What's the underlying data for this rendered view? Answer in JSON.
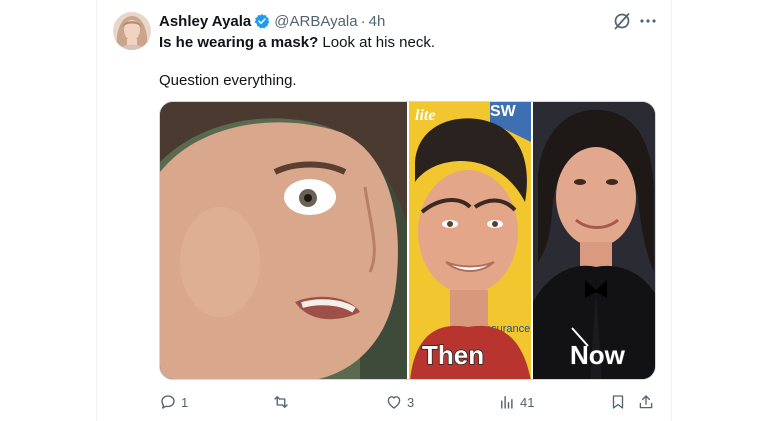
{
  "tweet": {
    "author_name": "Ashley Ayala",
    "handle": "@ARBAyala",
    "separator": "·",
    "time": "4h",
    "text_bold": "Is he wearing a mask?",
    "text_rest": " Look at his neck.",
    "text_line2": "Question everything.",
    "verified_color": "#1d9bf0"
  },
  "media": {
    "caption_then": "Then",
    "caption_now": "Now",
    "bg_text_left": "lite",
    "bg_text_top": "SW",
    "bg_text_side": "esurance"
  },
  "actions": {
    "reply_count": "1",
    "repost_count": "",
    "like_count": "3",
    "views_count": "41"
  },
  "colors": {
    "secondary_text": "#536471",
    "border": "#cfd9de",
    "brand_blue": "#1d9bf0"
  }
}
